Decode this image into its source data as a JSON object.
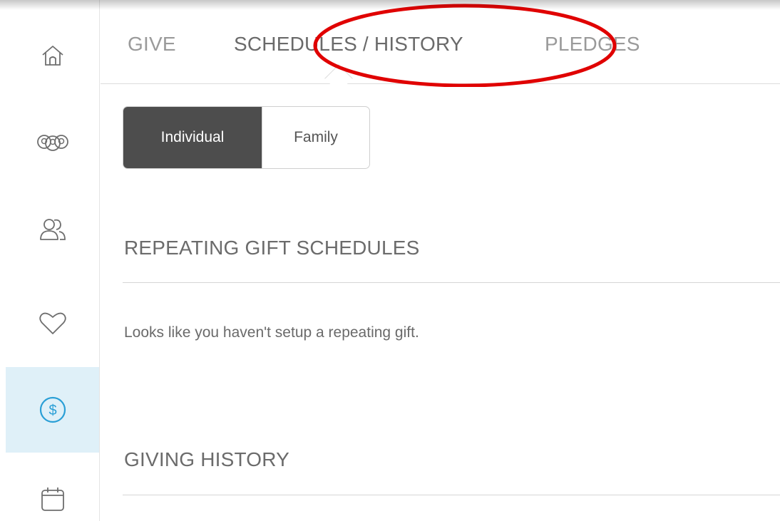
{
  "tabs": {
    "give": "GIVE",
    "schedules_history": "SCHEDULES / HISTORY",
    "pledges": "PLEDGES",
    "active": "schedules_history"
  },
  "sidebar": {
    "items": [
      {
        "icon": "home-icon"
      },
      {
        "icon": "groups-icon"
      },
      {
        "icon": "people-icon"
      },
      {
        "icon": "heart-icon"
      },
      {
        "icon": "dollar-icon",
        "active": true
      },
      {
        "icon": "calendar-icon"
      }
    ]
  },
  "segment": {
    "individual": "Individual",
    "family": "Family",
    "selected": "Individual"
  },
  "sections": {
    "repeating_title": "REPEATING GIFT SCHEDULES",
    "repeating_empty": "Looks like you haven't setup a repeating gift.",
    "history_title": "GIVING HISTORY"
  },
  "colors": {
    "active_sidebar_bg": "#dff0f8",
    "accent_blue": "#2a9fd6",
    "highlight_red": "#e00000",
    "selected_segment_bg": "#4d4d4d"
  }
}
